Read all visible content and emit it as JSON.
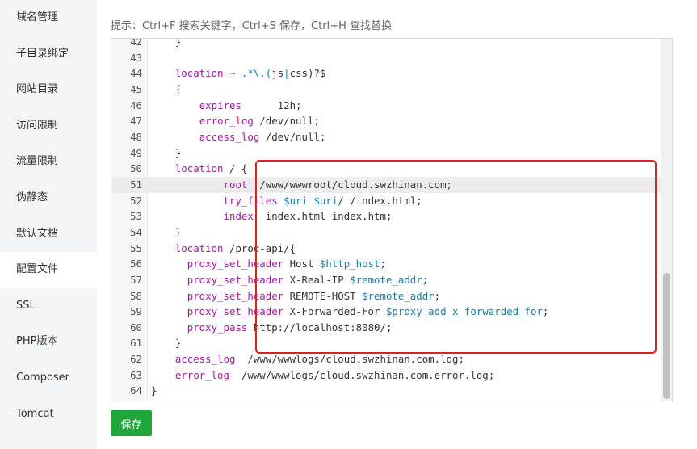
{
  "sidebar": {
    "items": [
      {
        "label": "域名管理"
      },
      {
        "label": "子目录绑定"
      },
      {
        "label": "网站目录"
      },
      {
        "label": "访问限制"
      },
      {
        "label": "流量限制"
      },
      {
        "label": "伪静态"
      },
      {
        "label": "默认文档"
      },
      {
        "label": "配置文件",
        "active": true
      },
      {
        "label": "SSL"
      },
      {
        "label": "PHP版本"
      },
      {
        "label": "Composer"
      },
      {
        "label": "Tomcat"
      }
    ]
  },
  "tip": "提示：Ctrl+F 搜索关键字，Ctrl+S 保存，Ctrl+H 查找替换",
  "editor": {
    "lines": [
      {
        "n": "42",
        "code": "    }"
      },
      {
        "n": "43",
        "code": ""
      },
      {
        "n": "44",
        "code": "    location ~ .*\\.(js|css)?$"
      },
      {
        "n": "45",
        "code": "    {"
      },
      {
        "n": "46",
        "code": "        expires      12h;"
      },
      {
        "n": "47",
        "code": "        error_log /dev/null;"
      },
      {
        "n": "48",
        "code": "        access_log /dev/null;"
      },
      {
        "n": "49",
        "code": "    }"
      },
      {
        "n": "50",
        "code": "    location / {"
      },
      {
        "n": "51",
        "code": "            root  /www/wwwroot/cloud.swzhinan.com;",
        "highlight": true
      },
      {
        "n": "52",
        "code": "            try_files $uri $uri/ /index.html;"
      },
      {
        "n": "53",
        "code": "            index  index.html index.htm;"
      },
      {
        "n": "54",
        "code": "    }"
      },
      {
        "n": "55",
        "code": "    location /prod-api/{"
      },
      {
        "n": "56",
        "code": "      proxy_set_header Host $http_host;"
      },
      {
        "n": "57",
        "code": "      proxy_set_header X-Real-IP $remote_addr;"
      },
      {
        "n": "58",
        "code": "      proxy_set_header REMOTE-HOST $remote_addr;"
      },
      {
        "n": "59",
        "code": "      proxy_set_header X-Forwarded-For $proxy_add_x_forwarded_for;"
      },
      {
        "n": "60",
        "code": "      proxy_pass http://localhost:8080/;"
      },
      {
        "n": "61",
        "code": "    }"
      },
      {
        "n": "62",
        "code": "    access_log  /www/wwwlogs/cloud.swzhinan.com.log;"
      },
      {
        "n": "63",
        "code": "    error_log  /www/wwwlogs/cloud.swzhinan.com.error.log;"
      },
      {
        "n": "64",
        "code": "}"
      }
    ]
  },
  "save_label": "保存",
  "colors": {
    "accent": "#20a53a",
    "highlight_box": "#e02020",
    "keyword": "#a11ba1",
    "variable": "#1c7aa6"
  }
}
